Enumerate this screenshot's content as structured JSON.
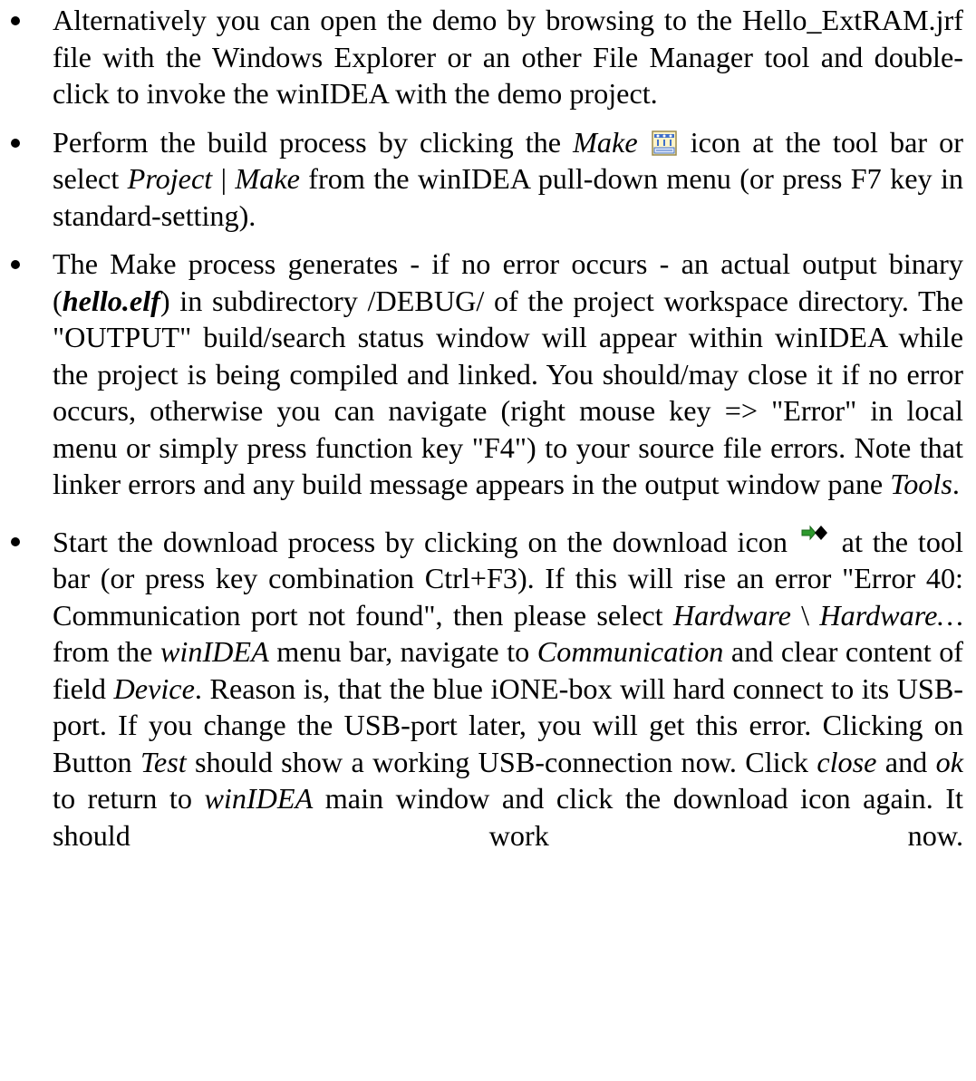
{
  "items": [
    {
      "text": "Alternatively you can open the demo by browsing to the Hello_ExtRAM.jrf file with the Windows Explorer or an other File Manager tool and double-click to invoke the winIDEA with the demo project."
    },
    {
      "t1": "Perform the build process by clicking the ",
      "make_em": "Make",
      "t2": " icon at the tool bar or select ",
      "project_em": "Project",
      "sep": " | ",
      "make2_em": "Make",
      "t3": " from the winIDEA pull-down menu (or press F7 key in standard-setting).",
      "icon": "make-build-icon"
    },
    {
      "t1": "The Make process generates - if no error occurs - an actual output binary (",
      "file_em": "hello.elf",
      "t2": ") in subdirectory /DEBUG/ of the project workspace directory. The \"OUTPUT\" build/search status window will appear within winIDEA while the project is being compiled and linked. You should/may close it if no error occurs, otherwise you can navigate (right mouse key => \"Error\" in local menu or simply press function key \"F4\") to your source file errors. Note that linker errors and any build message appears in the output window pane ",
      "tools_em": "Tools",
      "t3": "."
    },
    {
      "t1": "Start the download process by clicking on the download icon ",
      "icon": "download-arrow-icon",
      "t2": " at the tool bar (or press key combination Ctrl+F3). If this will rise an error \"Error 40: Communication port not found\", then please select ",
      "hw1": "Hardware",
      "t3": " \\ ",
      "hw2": "Hardware…",
      "t4": " from the ",
      "winidea1": "winIDEA",
      "t5": " menu bar, navigate to ",
      "comm": "Communication",
      "t6": " and clear content of field ",
      "device": "Device",
      "t7": ". Reason is, that the blue iONE-box will hard connect to its USB-port. If you change the USB-port later, you will get this error. Clicking on Button ",
      "test": "Test",
      "t8": " should show a working USB-connection now. Click ",
      "close": "close",
      "t9": " and ",
      "ok": "ok",
      "t10": " to return to ",
      "winidea2": "winIDEA",
      "t11": " main window and click the download icon again. It should work now."
    }
  ]
}
